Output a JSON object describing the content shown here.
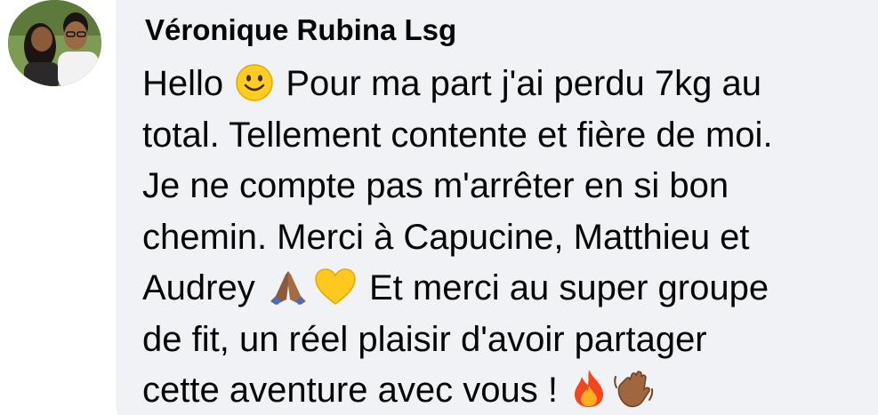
{
  "comment": {
    "author": "Véronique Rubina Lsg",
    "lines": [
      {
        "before": "Hello ",
        "emoji": "smiling-face-icon",
        "after": " Pour ma part j'ai perdu 7kg au"
      },
      {
        "text": "total. Tellement contente et fière de moi."
      },
      {
        "text": "Je ne compte pas m'arrêter en si bon"
      },
      {
        "text": "chemin. Merci à Capucine, Matthieu et"
      },
      {
        "before": "Audrey ",
        "emojis": [
          "folded-hands-icon",
          "yellow-heart-icon"
        ],
        "after": " Et merci au super groupe"
      },
      {
        "text": "de fit, un réel plaisir d'avoir partager"
      },
      {
        "before": "cette aventure avec vous ! ",
        "emojis": [
          "fire-icon",
          "waving-hand-icon"
        ]
      }
    ]
  },
  "colors": {
    "bubble": "#f0f2f5",
    "text": "#050505"
  }
}
